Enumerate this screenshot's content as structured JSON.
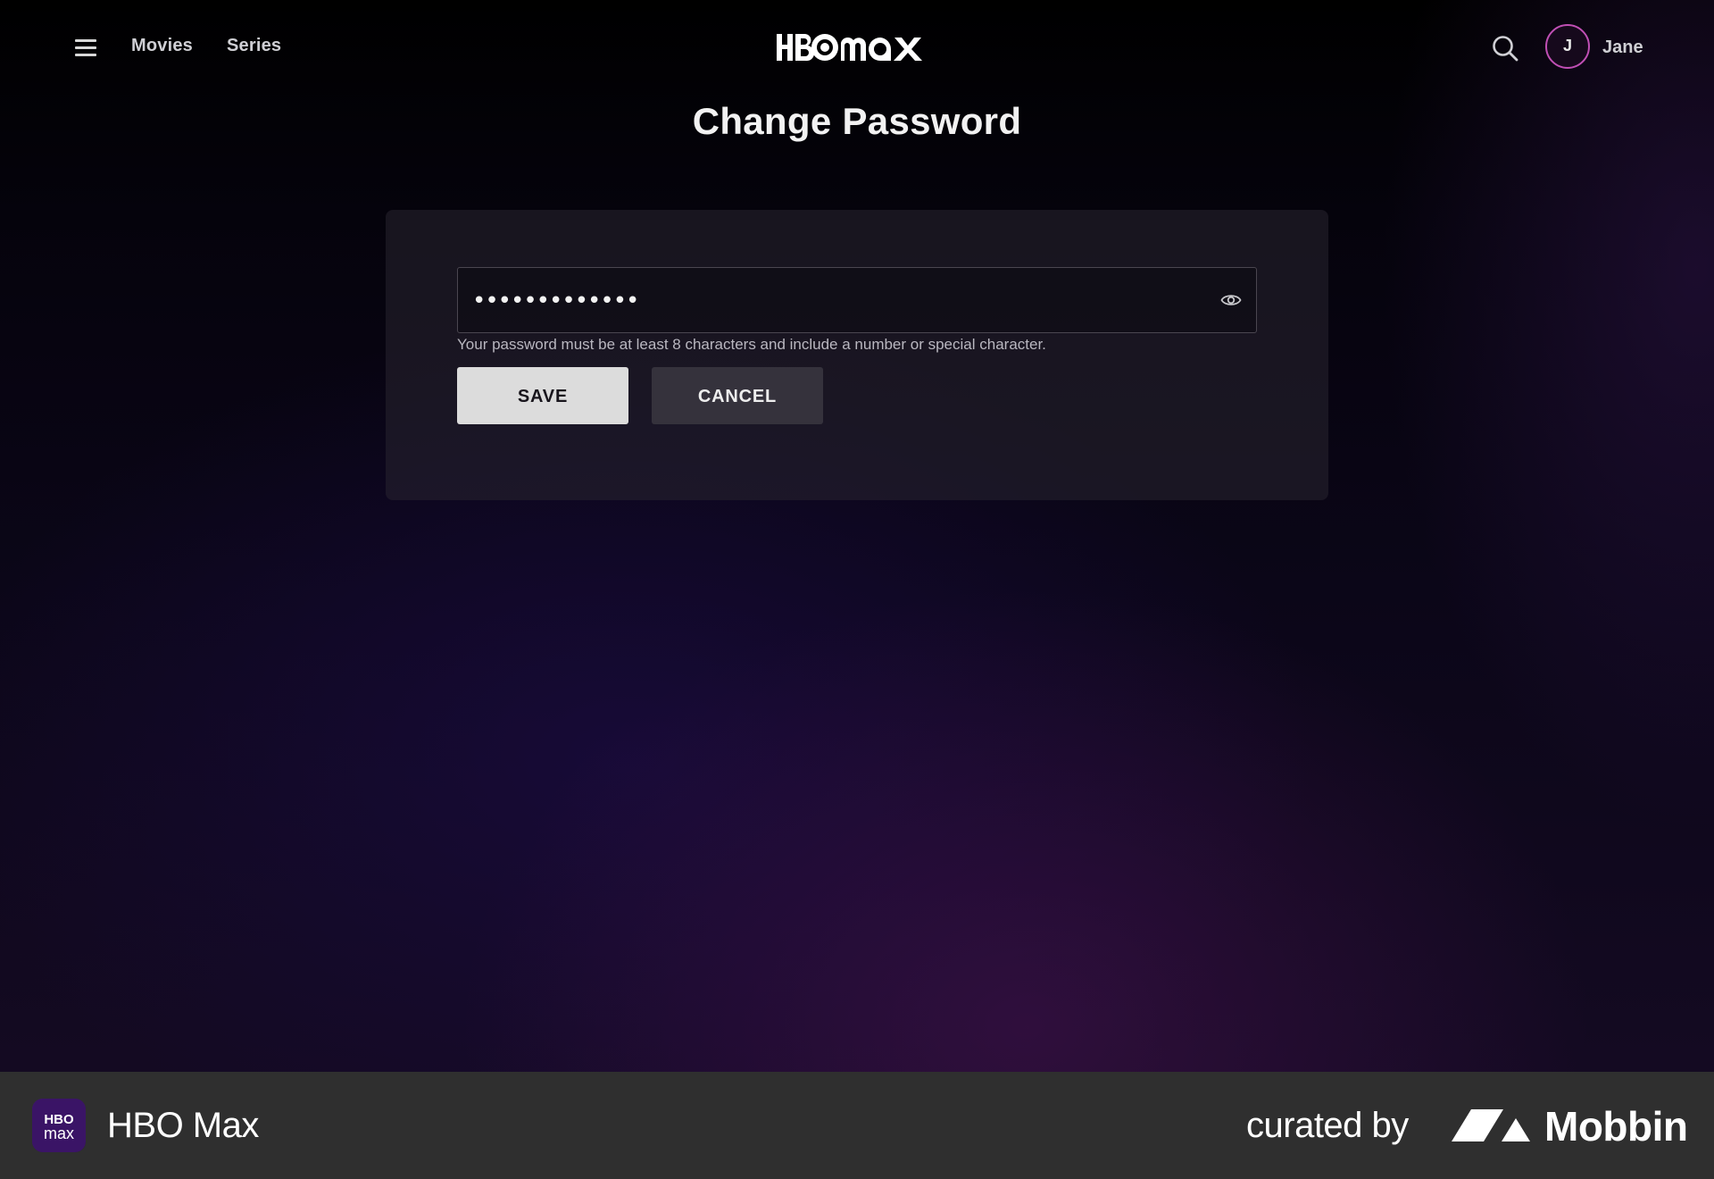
{
  "header": {
    "nav": [
      {
        "label": "Movies"
      },
      {
        "label": "Series"
      }
    ],
    "logo_text": "HBO max",
    "user": {
      "initial": "J",
      "name": "Jane"
    },
    "icons": {
      "menu": "hamburger-menu-icon",
      "search": "search-icon"
    }
  },
  "page": {
    "title": "Change Password"
  },
  "form": {
    "password_value": "•••••••••••••",
    "password_hint": "Your password must be at least 8 characters and include a number or special character.",
    "reveal_icon": "eye-icon",
    "save_label": "SAVE",
    "cancel_label": "CANCEL"
  },
  "footer": {
    "app_name": "HBO Max",
    "app_icon_text": "HBO max",
    "curated_by": "curated by",
    "brand": "Mobbin"
  },
  "colors": {
    "avatar_ring": "#c04fb4",
    "save_bg": "#dcdcdc",
    "cancel_bg": "#35323c",
    "footer_bg": "#2f2f2f"
  }
}
